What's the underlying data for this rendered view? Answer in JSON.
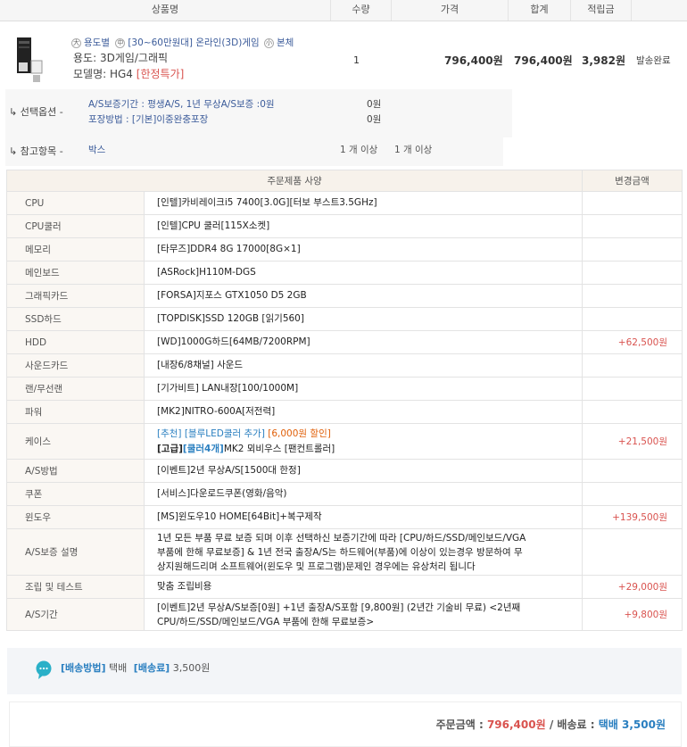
{
  "header": {
    "product": "상품명",
    "qty": "수량",
    "price": "가격",
    "total": "합계",
    "points": "적립금"
  },
  "product": {
    "line1_badges": [
      "大",
      "中",
      "小"
    ],
    "line1_a": "용도별",
    "line1_b": "[30~60만원대] 온라인(3D)게임",
    "line1_c": "본체",
    "usage": "용도: 3D게임/그래픽",
    "model_label": "모델명: HG4",
    "model_tag": "[한정특가]",
    "qty": "1",
    "price": "796,400원",
    "total": "796,400원",
    "points": "3,982원",
    "status": "발송완료"
  },
  "options": {
    "label": "선택옵션 -",
    "items": [
      {
        "text": "A/S보증기간 : 평생A/S, 1년 무상A/S보증 :0원",
        "price": "0원"
      },
      {
        "text": "포장방법 : [기본]이중완충포장",
        "price": "0원"
      }
    ]
  },
  "reference": {
    "label": "참고항목 -",
    "item": "박스",
    "q1": "1 개 이상",
    "q2": "1 개 이상"
  },
  "spec": {
    "head_spec": "주문제품 사양",
    "head_price": "변경금액",
    "rows": [
      {
        "k": "CPU",
        "v": "[인텔]카비레이크i5 7400[3.0G][터보 부스트3.5GHz]",
        "p": ""
      },
      {
        "k": "CPU쿨러",
        "v": "[인텔]CPU 쿨러[115X소켓]",
        "p": ""
      },
      {
        "k": "메모리",
        "v": "[타무즈]DDR4 8G 17000[8G×1]",
        "p": ""
      },
      {
        "k": "메인보드",
        "v": "[ASRock]H110M-DGS",
        "p": ""
      },
      {
        "k": "그래픽카드",
        "v": "[FORSA]지포스 GTX1050 D5 2GB",
        "p": ""
      },
      {
        "k": "SSD하드",
        "v": "[TOPDISK]SSD 120GB [읽기560]",
        "p": ""
      },
      {
        "k": "HDD",
        "v": "[WD]1000G하드[64MB/7200RPM]",
        "p": "+62,500원"
      },
      {
        "k": "사운드카드",
        "v": "[내장6/8채널] 사운드",
        "p": ""
      },
      {
        "k": "랜/무선랜",
        "v": "[기가비트] LAN내장[100/1000M]",
        "p": ""
      },
      {
        "k": "파워",
        "v": "[MK2]NITRO-600A[저전력]",
        "p": ""
      }
    ],
    "case": {
      "k": "케이스",
      "a": "[추천] [블루LED쿨러 추가]",
      "a_red": "[6,000원 할인]",
      "b1": "[고급]",
      "b2": "[쿨러4개]",
      "b3": "MK2 뫼비우스 [팬컨트롤러]",
      "p": "+21,500원"
    },
    "rows2": [
      {
        "k": "A/S방법",
        "v": "[이벤트]2년 무상A/S[1500대 한정]",
        "p": ""
      },
      {
        "k": "쿠폰",
        "v": "[서비스]다운로드쿠폰(영화/음악)",
        "p": ""
      },
      {
        "k": "윈도우",
        "v": "[MS]윈도우10 HOME[64Bit]+복구제작",
        "p": "+139,500원"
      }
    ],
    "warranty": {
      "k": "A/S보증 설명",
      "l1": "1년 모든 부품 무료 보증 되며 이후 선택하신 보증기간에 따라 [CPU/하드/SSD/메인보드/VGA",
      "l2": "부품에 한해 무료보증] & 1년 전국 출장A/S는 하드웨어(부품)에 이상이 있는경우 방문하여 무",
      "l3": "상지원해드리며 소프트웨어(윈도우 및 프로그램)문제인 경우에는 유상처리 됩니다",
      "p": ""
    },
    "assembly": {
      "k": "조립 및 테스트",
      "v": "맞춤 조립비용",
      "p": "+29,000원"
    },
    "asperiod": {
      "k": "A/S기간",
      "l1": "[이벤트]2년 무상A/S보증[0원] +1년 출장A/S포함 [9,800원] (2년간 기술비 무료) <2년째",
      "l2": "CPU/하드/SSD/메인보드/VGA 부품에 한해 무료보증>",
      "p": "+9,800원"
    }
  },
  "shipping": {
    "method_label": "[배송방법]",
    "method": "택배",
    "fee_label": "[배송료]",
    "fee": "3,500원"
  },
  "summary": {
    "order_label": "주문금액 :",
    "order": "796,400원",
    "sep": "/",
    "ship_label": "배송료 :",
    "ship_method": "택배",
    "ship_fee": "3,500원"
  },
  "colors": {
    "accent": "#2a7fc0",
    "price_red": "#d9534f",
    "highlight_red": "#e0600a",
    "shipping_icon": "#2ab0c8"
  }
}
